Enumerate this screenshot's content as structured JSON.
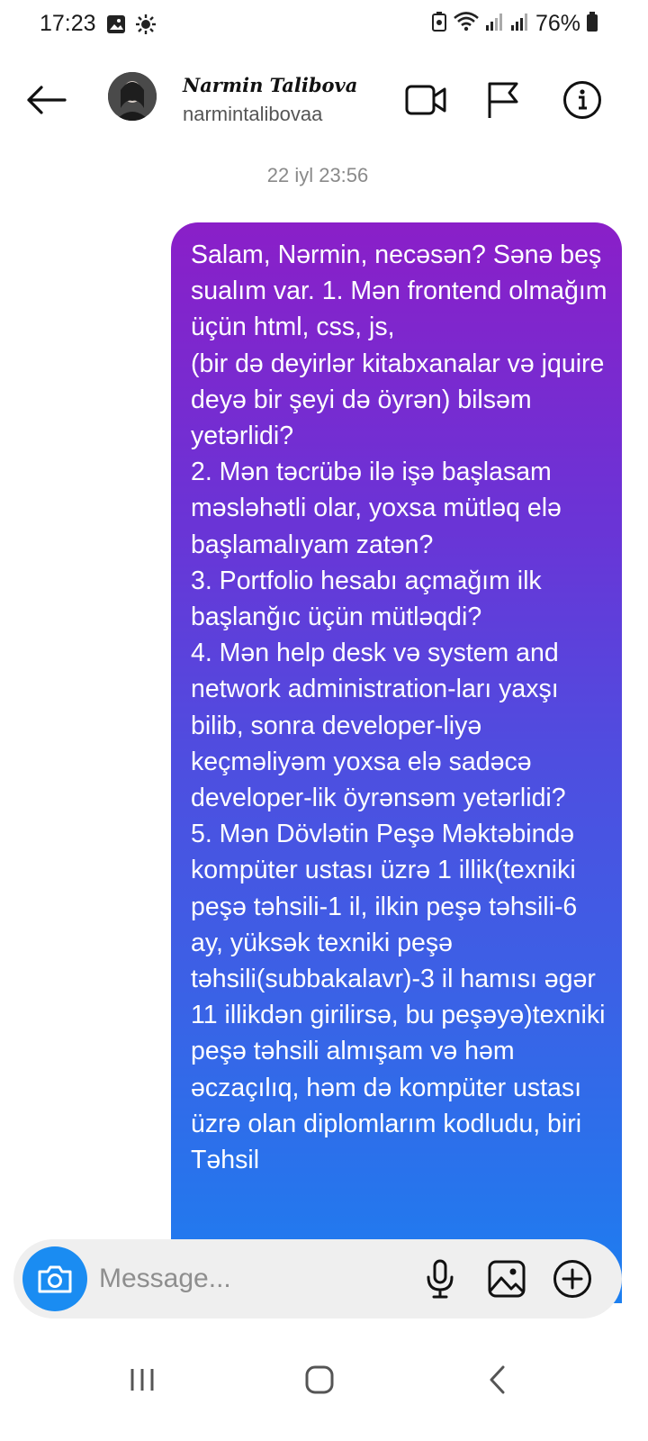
{
  "status_bar": {
    "time": "17:23",
    "battery": "76%"
  },
  "header": {
    "contact_name": "Narmin Talibova",
    "username": "narmintalibovaa"
  },
  "conversation": {
    "date_stamp": "22 iyl 23:56",
    "messages": [
      {
        "sender": "me",
        "text": "Salam, Nərmin, necəsən? Sənə beş sualım var. 1. Mən frontend olmağım üçün html, css, js,\n(bir də deyirlər kitabxanalar və jquire deyə bir şeyi də öyrən) bilsəm yetərlidi?\n2. Mən təcrübə ilə işə başlasam məsləhətli olar, yoxsa mütləq elə  başlamalıyam zatən?\n3. Portfolio hesabı açmağım ilk başlanğıc üçün mütləqdi?\n4. Mən help desk və system and network administration-ları yaxşı bilib, sonra developer-liyə keçməliyəm yoxsa elə sadəcə developer-lik öyrənsəm yetərlidi?\n5. Mən Dövlətin Peşə Məktəbində kompüter ustası üzrə 1 illik(texniki peşə təhsili-1 il, ilkin peşə təhsili-6 ay, yüksək texniki peşə təhsili(subbakalavr)-3 il hamısı əgər 11 illikdən girilirsə, bu peşəyə)texniki peşə təhsili almışam və həm əczaçılıq, həm də kompüter ustası üzrə olan diplomlarım kodludu, biri Təhsil"
      }
    ]
  },
  "composer": {
    "placeholder": "Message..."
  },
  "colors": {
    "bubble_top": "#8a1fc8",
    "bubble_bottom": "#1c7ff0",
    "camera_button": "#1a8cf2"
  },
  "icons": [
    "back-arrow-icon",
    "video-call-icon",
    "flag-icon",
    "info-icon",
    "camera-icon",
    "microphone-icon",
    "gallery-icon",
    "plus-icon",
    "gallery-status-icon",
    "settings-status-icon",
    "wifi-icon",
    "signal-icon",
    "battery-icon",
    "recent-apps-icon",
    "home-icon",
    "nav-back-icon"
  ]
}
